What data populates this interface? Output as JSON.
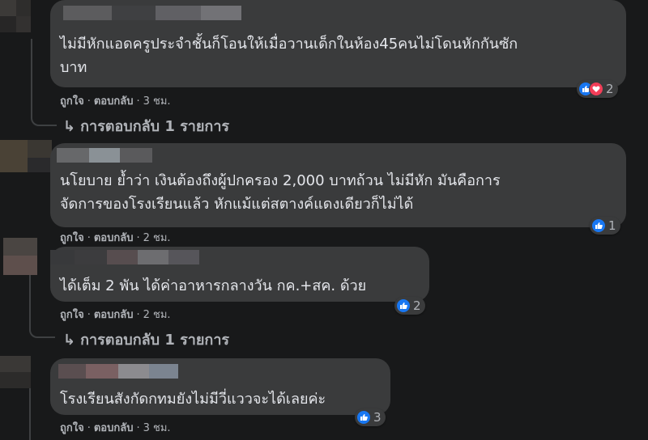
{
  "comments": [
    {
      "text": "ไม่มีหักแอดครูประจำชั้นก็โอนให้เมื่อวานเด็กในห้อง45คนไม่โดนหักกันซัก\nบาท",
      "like_label": "ถูกใจ",
      "reply_label": "ตอบกลับ",
      "time": "3 ชม.",
      "reactions": [
        "like-icon",
        "love-icon"
      ],
      "reaction_count": "2",
      "replies_label": "การตอบกลับ 1 รายการ"
    },
    {
      "text": "นโยบาย ย้ำว่า เงินต้องถึงผู้ปกครอง 2,000 บาทถ้วน ไม่มีหัก มันคือการ\nจัดการของโรงเรียนแล้ว หักแม้แต่สตางค์แดงเดียวก็ไม่ได้",
      "like_label": "ถูกใจ",
      "reply_label": "ตอบกลับ",
      "time": "2 ชม.",
      "reactions": [
        "like-icon"
      ],
      "reaction_count": "1"
    },
    {
      "text": "ได้เต็ม 2 พัน ได้ค่าอาหารกลางวัน กค.+สค. ด้วย",
      "like_label": "ถูกใจ",
      "reply_label": "ตอบกลับ",
      "time": "2 ชม.",
      "reactions": [
        "like-icon"
      ],
      "reaction_count": "2",
      "replies_label": "การตอบกลับ 1 รายการ"
    },
    {
      "text": "โรงเรียนสังกัดกทมยังไม่มีวี่แววจะได้เลยค่ะ",
      "like_label": "ถูกใจ",
      "reply_label": "ตอบกลับ",
      "time": "3 ชม.",
      "reactions": [
        "like-icon"
      ],
      "reaction_count": "3"
    }
  ],
  "colors": {
    "background": "#18191a",
    "bubble": "#3a3b3c",
    "text": "#e4e6eb",
    "secondary_text": "#b0b3b8",
    "like_blue": "#1877f2",
    "love_red": "#f33e58"
  }
}
